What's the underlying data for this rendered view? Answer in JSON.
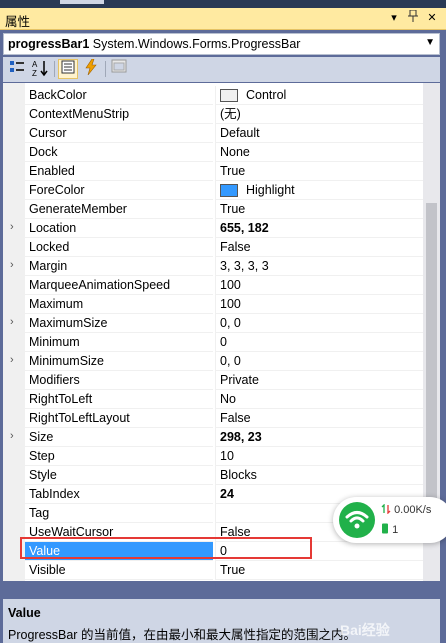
{
  "panel": {
    "title": "属性",
    "pin_glyph": "▾",
    "autohide_glyph": "⇩",
    "close_glyph": "✕"
  },
  "object_selector": {
    "name": "progressBar1",
    "type": "System.Windows.Forms.ProgressBar"
  },
  "properties": [
    {
      "name": "BackColor",
      "value": "Control",
      "swatch": "#f0f0f0",
      "expandable": false,
      "bold": false
    },
    {
      "name": "ContextMenuStrip",
      "value": "(无)",
      "expandable": false,
      "bold": false
    },
    {
      "name": "Cursor",
      "value": "Default",
      "expandable": false,
      "bold": false
    },
    {
      "name": "Dock",
      "value": "None",
      "expandable": false,
      "bold": false
    },
    {
      "name": "Enabled",
      "value": "True",
      "expandable": false,
      "bold": false
    },
    {
      "name": "ForeColor",
      "value": "Highlight",
      "swatch": "#3399ff",
      "expandable": false,
      "bold": false
    },
    {
      "name": "GenerateMember",
      "value": "True",
      "expandable": false,
      "bold": false
    },
    {
      "name": "Location",
      "value": "655, 182",
      "expandable": true,
      "bold": true
    },
    {
      "name": "Locked",
      "value": "False",
      "expandable": false,
      "bold": false
    },
    {
      "name": "Margin",
      "value": "3, 3, 3, 3",
      "expandable": true,
      "bold": false
    },
    {
      "name": "MarqueeAnimationSpeed",
      "value": "100",
      "expandable": false,
      "bold": false
    },
    {
      "name": "Maximum",
      "value": "100",
      "expandable": false,
      "bold": false
    },
    {
      "name": "MaximumSize",
      "value": "0, 0",
      "expandable": true,
      "bold": false
    },
    {
      "name": "Minimum",
      "value": "0",
      "expandable": false,
      "bold": false
    },
    {
      "name": "MinimumSize",
      "value": "0, 0",
      "expandable": true,
      "bold": false
    },
    {
      "name": "Modifiers",
      "value": "Private",
      "expandable": false,
      "bold": false
    },
    {
      "name": "RightToLeft",
      "value": "No",
      "expandable": false,
      "bold": false
    },
    {
      "name": "RightToLeftLayout",
      "value": "False",
      "expandable": false,
      "bold": false
    },
    {
      "name": "Size",
      "value": "298, 23",
      "expandable": true,
      "bold": true
    },
    {
      "name": "Step",
      "value": "10",
      "expandable": false,
      "bold": false
    },
    {
      "name": "Style",
      "value": "Blocks",
      "expandable": false,
      "bold": false
    },
    {
      "name": "TabIndex",
      "value": "24",
      "expandable": false,
      "bold": true
    },
    {
      "name": "Tag",
      "value": "",
      "expandable": false,
      "bold": false
    },
    {
      "name": "UseWaitCursor",
      "value": "False",
      "expandable": false,
      "bold": false
    },
    {
      "name": "Value",
      "value": "0",
      "expandable": false,
      "bold": false,
      "selected": true
    },
    {
      "name": "Visible",
      "value": "True",
      "expandable": false,
      "bold": false
    }
  ],
  "description": {
    "title": "Value",
    "text": "ProgressBar 的当前值，在由最小和最大属性指定的范围之内。"
  },
  "network_widget": {
    "speed": "0.00K/s",
    "connections": "1"
  },
  "watermark": "Bai经验",
  "colors": {
    "selection": "#3399ff",
    "highlight_box": "#e53935",
    "title_bar": "#ffeaa1"
  }
}
